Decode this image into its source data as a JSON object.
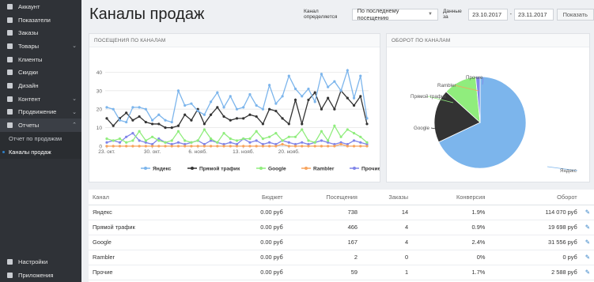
{
  "sidebar": {
    "items": [
      {
        "label": "Аккаунт",
        "icon": "user-icon",
        "chevron": false
      },
      {
        "label": "Показатели",
        "icon": "gauge-icon",
        "chevron": false
      },
      {
        "label": "Заказы",
        "icon": "cart-icon",
        "chevron": false
      },
      {
        "label": "Товары",
        "icon": "box-icon",
        "chevron": true
      },
      {
        "label": "Клиенты",
        "icon": "users-icon",
        "chevron": false
      },
      {
        "label": "Скидки",
        "icon": "percent-icon",
        "chevron": false
      },
      {
        "label": "Дизайн",
        "icon": "brush-icon",
        "chevron": false
      },
      {
        "label": "Контент",
        "icon": "document-icon",
        "chevron": true
      },
      {
        "label": "Продвижение",
        "icon": "megaphone-icon",
        "chevron": true
      },
      {
        "label": "Отчеты",
        "icon": "pie-chart-icon",
        "chevron": true,
        "active": true
      }
    ],
    "subitems": [
      {
        "label": "Отчет по продажам"
      },
      {
        "label": "Каналы продаж",
        "current": true
      }
    ],
    "bottom": [
      {
        "label": "Настройки",
        "icon": "gear-icon"
      },
      {
        "label": "Приложения",
        "icon": "puzzle-icon"
      }
    ]
  },
  "page": {
    "title": "Каналы продаж"
  },
  "filters": {
    "channel_label": "Канал определяется",
    "channel_value": "По последнему посещению",
    "date_label": "Данные за",
    "date_from": "23.10.2017",
    "date_dash": "-",
    "date_to": "23.11.2017",
    "show_button": "Показать"
  },
  "visits_panel": {
    "title": "ПОСЕЩЕНИЯ ПО КАНАЛАМ"
  },
  "revenue_panel": {
    "title": "ОБОРОТ ПО КАНАЛАМ"
  },
  "table": {
    "headers": [
      "Канал",
      "Бюджет",
      "Посещения",
      "Заказы",
      "Конверсия",
      "Оборот"
    ],
    "rows": [
      {
        "channel": "Яндекс",
        "budget": "0.00 руб",
        "visits": "738",
        "orders": "14",
        "conversion": "1.9%",
        "revenue": "114 070 руб"
      },
      {
        "channel": "Прямой трафик",
        "budget": "0.00 руб",
        "visits": "466",
        "orders": "4",
        "conversion": "0.9%",
        "revenue": "19 698 руб"
      },
      {
        "channel": "Google",
        "budget": "0.00 руб",
        "visits": "167",
        "orders": "4",
        "conversion": "2.4%",
        "revenue": "31 556 руб"
      },
      {
        "channel": "Rambler",
        "budget": "0.00 руб",
        "visits": "2",
        "orders": "0",
        "conversion": "0%",
        "revenue": "0 руб"
      },
      {
        "channel": "Прочие",
        "budget": "0.00 руб",
        "visits": "59",
        "orders": "1",
        "conversion": "1.7%",
        "revenue": "2 588 руб"
      }
    ]
  },
  "chart_data": [
    {
      "type": "line",
      "title": "ПОСЕЩЕНИЯ ПО КАНАЛАМ",
      "ylim": [
        0,
        50
      ],
      "yticks": [
        "0",
        "10",
        "20",
        "30",
        "40"
      ],
      "xtick_labels": [
        "23. окт.",
        "30. окт.",
        "6. нояб.",
        "13. нояб.",
        "20. нояб."
      ],
      "grid": true,
      "legend": "bottom",
      "series": [
        {
          "name": "Яндекс",
          "color": "#7cb5ec",
          "values": [
            21,
            20,
            14,
            13,
            21,
            21,
            20,
            14,
            17,
            14,
            13,
            30,
            22,
            23,
            19,
            17,
            24,
            29,
            21,
            27,
            20,
            21,
            28,
            22,
            20,
            33,
            23,
            27,
            38,
            31,
            27,
            31,
            24,
            39,
            32,
            35,
            30,
            41,
            26,
            38,
            15
          ]
        },
        {
          "name": "Прямой трафик",
          "color": "#333333",
          "values": [
            15,
            11,
            15,
            18,
            14,
            16,
            13,
            12,
            12,
            10,
            10,
            11,
            17,
            14,
            20,
            12,
            17,
            21,
            16,
            14,
            15,
            15,
            17,
            16,
            12,
            20,
            19,
            15,
            12,
            25,
            12,
            25,
            29,
            20,
            26,
            20,
            30,
            26,
            22,
            27,
            12
          ]
        },
        {
          "name": "Google",
          "color": "#90ed7d",
          "values": [
            4,
            3,
            4,
            2,
            3,
            8,
            3,
            5,
            3,
            2,
            3,
            8,
            3,
            2,
            3,
            9,
            4,
            2,
            7,
            4,
            3,
            4,
            4,
            8,
            4,
            5,
            7,
            3,
            5,
            5,
            9,
            3,
            2,
            8,
            3,
            11,
            5,
            9,
            7,
            5,
            2
          ]
        },
        {
          "name": "Rambler",
          "color": "#f7a35c",
          "values": [
            0,
            0,
            0,
            0,
            0,
            0,
            0,
            0,
            0,
            0,
            0,
            0,
            0,
            0,
            0,
            0,
            0,
            0,
            0,
            0,
            0,
            0,
            0,
            0,
            0,
            0,
            0,
            1,
            0,
            0,
            0,
            0,
            0,
            0,
            0,
            0,
            1,
            0,
            0,
            0,
            0
          ]
        },
        {
          "name": "Прочие",
          "color": "#8085e9",
          "values": [
            2,
            3,
            2,
            5,
            7,
            3,
            2,
            1,
            4,
            2,
            1,
            2,
            1,
            2,
            3,
            1,
            3,
            2,
            1,
            2,
            1,
            4,
            2,
            3,
            1,
            2,
            1,
            3,
            2,
            1,
            2,
            1,
            2,
            3,
            2,
            1,
            2,
            1,
            3,
            2,
            1
          ]
        }
      ]
    },
    {
      "type": "pie",
      "title": "ОБОРОТ ПО КАНАЛАМ",
      "slices": [
        {
          "name": "Яндекс",
          "value": 114070,
          "color": "#7cb5ec"
        },
        {
          "name": "Прямой трафик",
          "value": 19698,
          "color": "#90ed7d"
        },
        {
          "name": "Google",
          "value": 31556,
          "color": "#333333"
        },
        {
          "name": "Rambler",
          "value": 0,
          "color": "#f7a35c"
        },
        {
          "name": "Прочие",
          "value": 2588,
          "color": "#8085e9"
        }
      ]
    }
  ]
}
